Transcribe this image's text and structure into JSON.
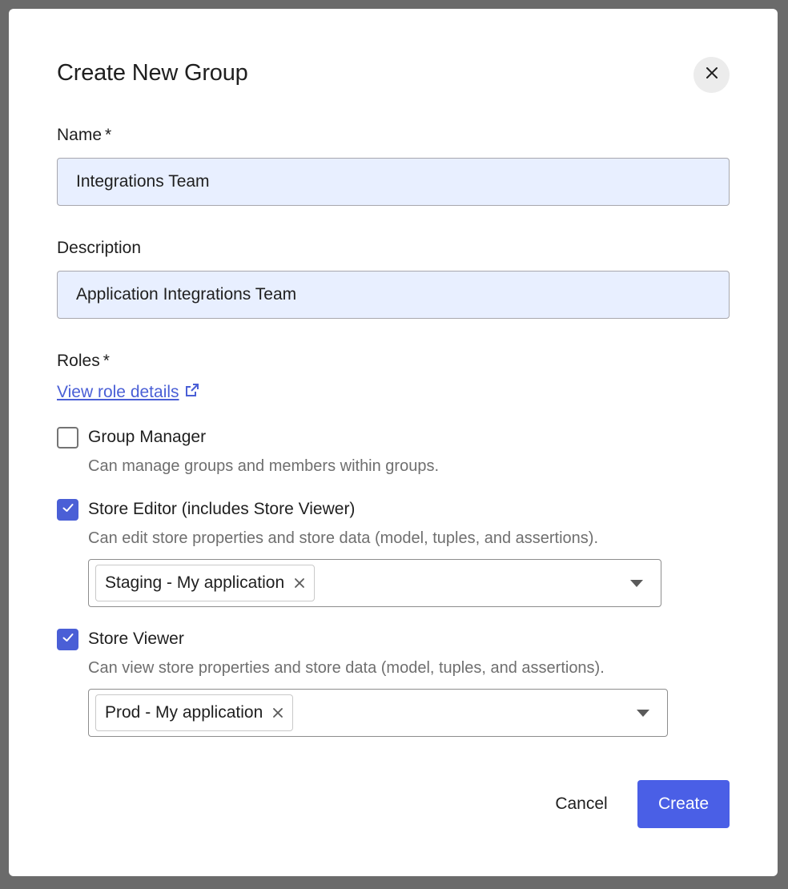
{
  "dialog": {
    "title": "Create New Group"
  },
  "form": {
    "name": {
      "label": "Name",
      "required_mark": "*",
      "value": "Integrations Team"
    },
    "description": {
      "label": "Description",
      "value": "Application Integrations Team"
    },
    "roles": {
      "label": "Roles",
      "required_mark": "*",
      "details_link": "View role details",
      "items": [
        {
          "title": "Group Manager",
          "description": "Can manage groups and members within groups.",
          "checked": false
        },
        {
          "title": "Store Editor (includes Store Viewer)",
          "description": "Can edit store properties and store data (model, tuples, and assertions).",
          "checked": true,
          "selected_store": "Staging - My application"
        },
        {
          "title": "Store Viewer",
          "description": "Can view store properties and store data (model, tuples, and assertions).",
          "checked": true,
          "selected_store": "Prod - My application"
        }
      ]
    }
  },
  "actions": {
    "cancel_label": "Cancel",
    "create_label": "Create"
  },
  "colors": {
    "accent": "#4a5fe6",
    "link": "#4a5fd6",
    "input_fill": "#e8efff"
  },
  "icons": {
    "close": "close-icon",
    "external_link": "external-link-icon",
    "check": "check-icon",
    "chip_remove": "remove-icon",
    "dropdown": "caret-down-icon"
  }
}
